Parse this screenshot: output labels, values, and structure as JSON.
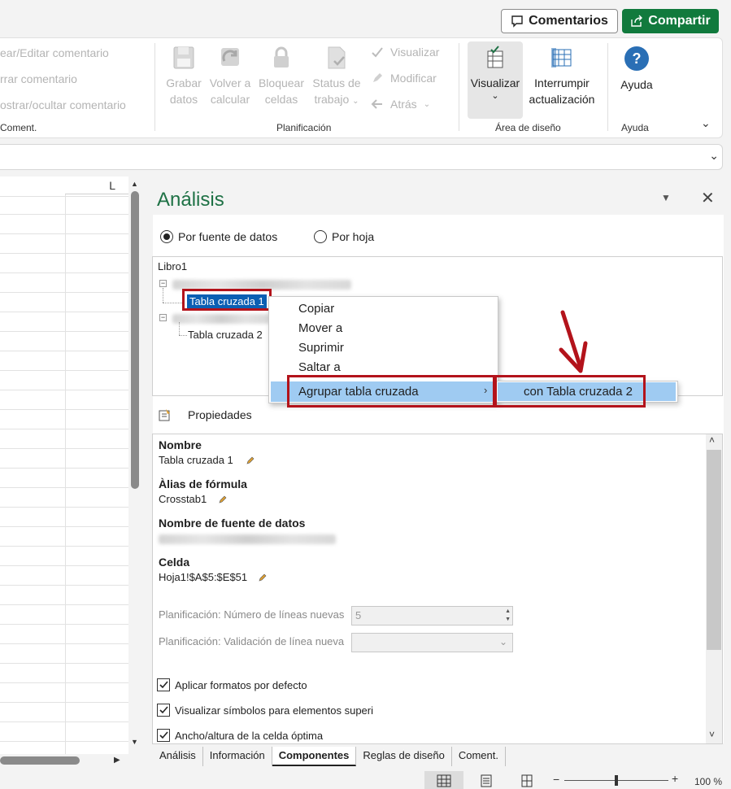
{
  "topbar": {
    "comments_label": "Comentarios",
    "share_label": "Compartir"
  },
  "ribbon": {
    "comments_group": {
      "items": [
        "ear/Editar comentario",
        "rrar comentario",
        "ostrar/ocultar comentario"
      ],
      "label": "Coment."
    },
    "planning_group": {
      "big_buttons": [
        {
          "line1": "Grabar",
          "line2": "datos"
        },
        {
          "line1": "Volver a",
          "line2": "calcular"
        },
        {
          "line1": "Bloquear",
          "line2": "celdas"
        },
        {
          "line1": "Status de",
          "line2": "trabajo"
        }
      ],
      "small_buttons": [
        "Visualizar",
        "Modificar",
        "Atrás"
      ],
      "label": "Planificación"
    },
    "design_group": {
      "visualize": "Visualizar",
      "interrupt_line1": "Interrumpir",
      "interrupt_line2": "actualización",
      "label": "Área de diseño"
    },
    "help_group": {
      "help": "Ayuda",
      "label": "Ayuda"
    }
  },
  "sheet": {
    "column_label": "L"
  },
  "pane": {
    "title": "Análisis",
    "radio_by_source": "Por fuente de datos",
    "radio_by_sheet": "Por hoja",
    "tree": {
      "root": "Libro1",
      "crosstab1": "Tabla cruzada 1",
      "crosstab2": "Tabla cruzada 2"
    },
    "context_menu": {
      "copy": "Copiar",
      "move": "Mover a",
      "delete": "Suprimir",
      "jump": "Saltar a",
      "group": "Agrupar tabla cruzada",
      "submenu_item": "con Tabla cruzada 2"
    },
    "properties_label": "Propiedades",
    "properties": {
      "name_label": "Nombre",
      "name_value": "Tabla cruzada 1",
      "alias_label": "Àlias de fórmula",
      "alias_value": "Crosstab1",
      "source_label": "Nombre de fuente de datos",
      "cell_label": "Celda",
      "cell_value": "Hoja1!$A$5:$E$51",
      "planning_new_lines_label": "Planificación: Número de líneas nuevas",
      "planning_new_lines_value": "5",
      "planning_validation_label": "Planificación: Validación de línea nueva",
      "check_apply_formats": "Aplicar formatos por defecto",
      "check_show_symbols": "Visualizar símbolos para elementos superi",
      "check_optimal_size": "Ancho/altura de la celda óptima"
    },
    "tabs": [
      "Análisis",
      "Información",
      "Componentes",
      "Reglas de diseño",
      "Coment."
    ],
    "active_tab": "Componentes"
  },
  "statusbar": {
    "zoom": "100 %"
  },
  "colors": {
    "accent_green": "#117a3d",
    "title_green": "#1e7145",
    "highlight_red": "#b3131b",
    "selection_blue": "#0b5fb3",
    "menu_highlight": "#9fcbf2"
  }
}
